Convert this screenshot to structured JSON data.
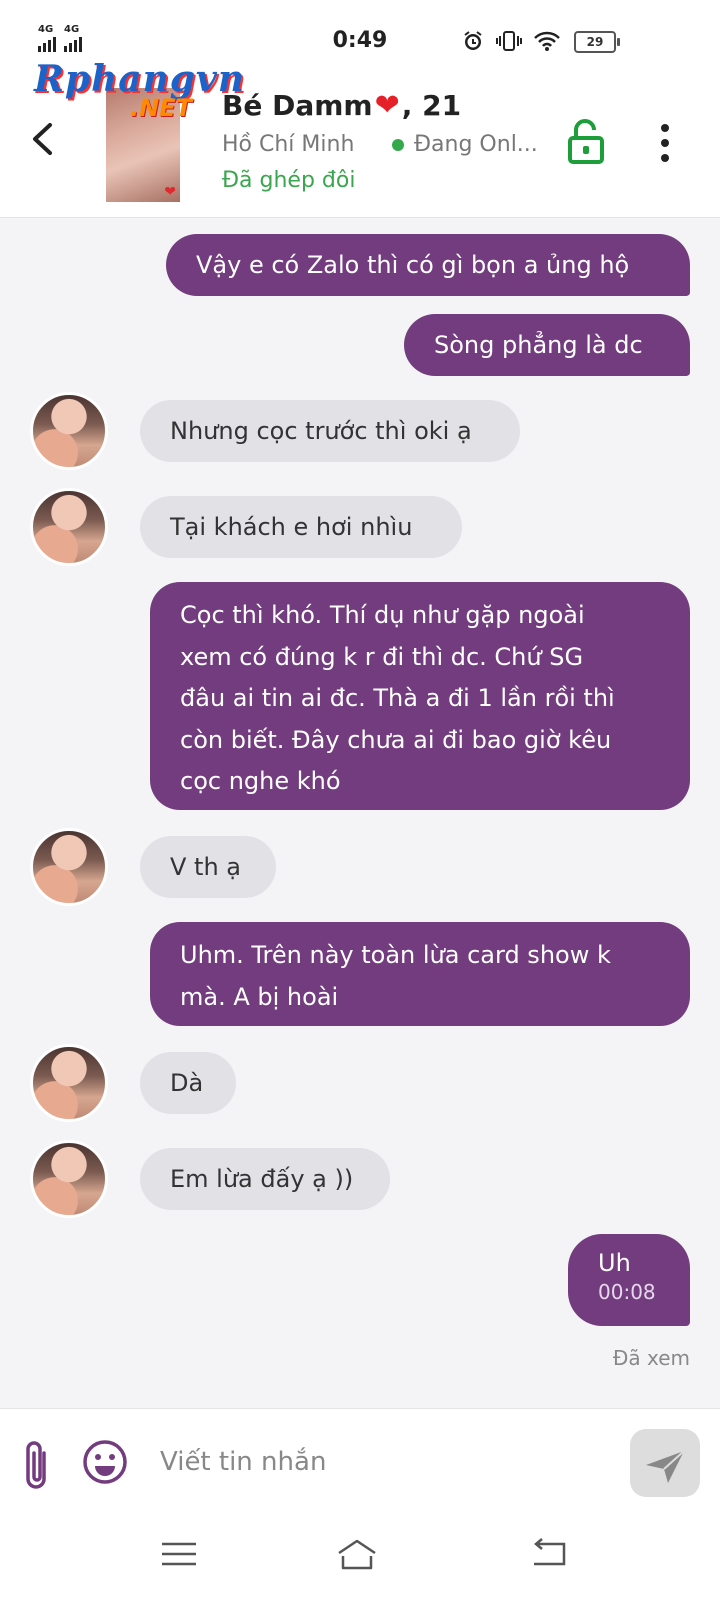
{
  "status_bar": {
    "time": "0:49",
    "network_1": "4G",
    "network_2": "4G",
    "battery": "29",
    "icons": [
      "alarm-icon",
      "vibrate-icon",
      "wifi-icon"
    ]
  },
  "header": {
    "watermark_logo_main": "Rphangvn",
    "watermark_logo_sub": ".NET",
    "name": "Bé Damm",
    "age": ", 21",
    "city": "Hồ Chí Minh",
    "online_status": "Đang Onl...",
    "match_status": "Đã ghép đôi"
  },
  "messages": [
    {
      "from": "me",
      "text": "Vậy e có Zalo thì có gì bọn a ủng hộ"
    },
    {
      "from": "me",
      "text": "Sòng phẳng là dc"
    },
    {
      "from": "them",
      "text": "Nhưng cọc trước thì oki ạ"
    },
    {
      "from": "them",
      "text": "Tại khách e hơi nhìu"
    },
    {
      "from": "me",
      "lines": [
        "Cọc thì khó. Thí dụ như gặp ngoài",
        "xem có đúng k r đi thì dc. Chứ SG",
        "đâu ai tin ai đc. Thà a đi 1 lần rồi thì",
        "còn biết. Đây chưa ai đi bao giờ kêu",
        "cọc nghe khó"
      ]
    },
    {
      "from": "them",
      "text": "V th ạ"
    },
    {
      "from": "me",
      "lines": [
        "Uhm. Trên này toàn lừa card show k",
        "mà. A bị hoài"
      ]
    },
    {
      "from": "them",
      "text": "Dà"
    },
    {
      "from": "them",
      "text": "Em lừa đấy ạ ))"
    },
    {
      "from": "me",
      "text": "Uh",
      "time": "00:08"
    }
  ],
  "seen_label": "Đã xem",
  "composer": {
    "placeholder": "Viết tin nhắn"
  },
  "colors": {
    "outgoing_bubble": "#733c7e",
    "incoming_bubble": "#e2e2e6",
    "online_dot": "#34a94b",
    "match_text": "#3aa64f",
    "lock_icon": "#1e9e3a"
  }
}
